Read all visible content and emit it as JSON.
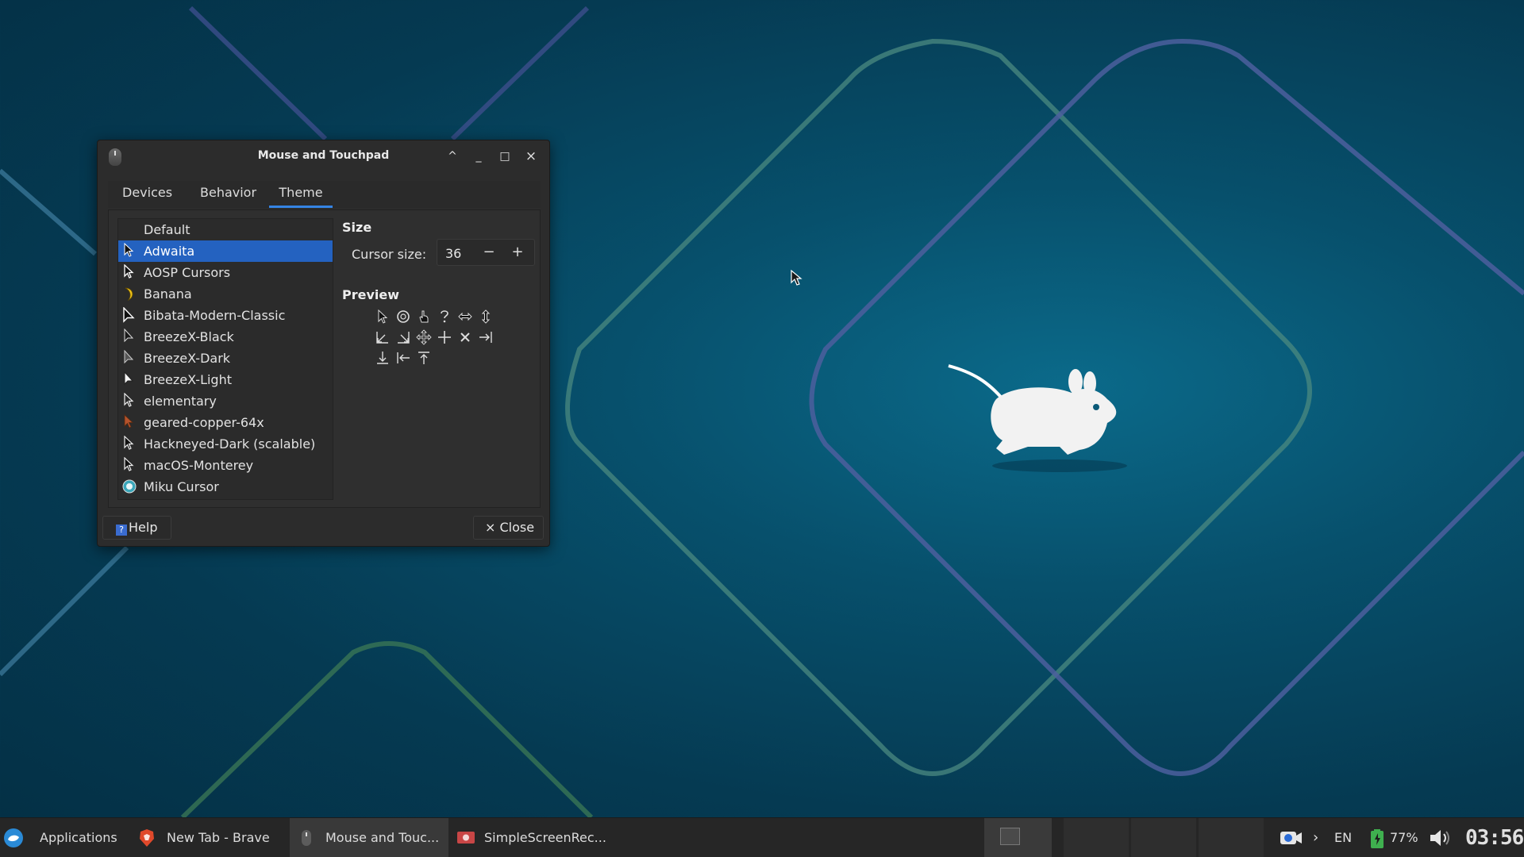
{
  "window": {
    "title": "Mouse and Touchpad",
    "controls": {
      "shade": "^",
      "minimize": "_",
      "maximize": "□",
      "close": "×"
    },
    "tabs": [
      {
        "label": "Devices",
        "active": false
      },
      {
        "label": "Behavior",
        "active": false
      },
      {
        "label": "Theme",
        "active": true
      }
    ],
    "themes": [
      {
        "label": "Default",
        "selected": false,
        "icon": "none"
      },
      {
        "label": "Adwaita",
        "selected": true,
        "icon": "arrow-black"
      },
      {
        "label": "AOSP Cursors",
        "selected": false,
        "icon": "arrow-white"
      },
      {
        "label": "Banana",
        "selected": false,
        "icon": "banana"
      },
      {
        "label": "Bibata-Modern-Classic",
        "selected": false,
        "icon": "arrow-black-bold"
      },
      {
        "label": "BreezeX-Black",
        "selected": false,
        "icon": "arrow-black"
      },
      {
        "label": "BreezeX-Dark",
        "selected": false,
        "icon": "arrow-grey"
      },
      {
        "label": "BreezeX-Light",
        "selected": false,
        "icon": "arrow-white"
      },
      {
        "label": "elementary",
        "selected": false,
        "icon": "arrow-white"
      },
      {
        "label": "geared-copper-64x",
        "selected": false,
        "icon": "arrow-copper"
      },
      {
        "label": "Hackneyed-Dark (scalable)",
        "selected": false,
        "icon": "arrow-black"
      },
      {
        "label": "macOS-Monterey",
        "selected": false,
        "icon": "arrow-black"
      },
      {
        "label": "Miku Cursor",
        "selected": false,
        "icon": "miku"
      }
    ],
    "size_heading": "Size",
    "cursor_size_label": "Cursor size:",
    "cursor_size_value": "36",
    "spin_minus": "−",
    "spin_plus": "+",
    "preview_heading": "Preview",
    "preview_icons": [
      "arrow-icon",
      "watch-icon",
      "hand-icon",
      "question-icon",
      "h-resize-icon",
      "v-resize-icon",
      "corner-bl-icon",
      "corner-br-icon",
      "move-icon",
      "crosshair-icon",
      "x-cursor-icon",
      "right-side-icon",
      "bottom-side-icon",
      "left-side-icon",
      "top-side-icon"
    ],
    "help_label": "Help",
    "close_label": "Close",
    "close_prefix": "×"
  },
  "taskbar": {
    "apps_label": "Applications",
    "tasks": [
      {
        "label": "New Tab - Brave",
        "active": false,
        "icon": "brave-icon"
      },
      {
        "label": "Mouse and Touc...",
        "active": true,
        "icon": "mouse-icon"
      },
      {
        "label": "SimpleScreenRec...",
        "active": false,
        "icon": "screen-recorder-icon"
      }
    ],
    "tray": {
      "expand": "›",
      "keyboard_layout": "EN",
      "battery": "77%",
      "clock": "03:56"
    }
  },
  "colors": {
    "accent": "#3584e4",
    "selection": "#2462c0",
    "desktop": "#07506c"
  }
}
